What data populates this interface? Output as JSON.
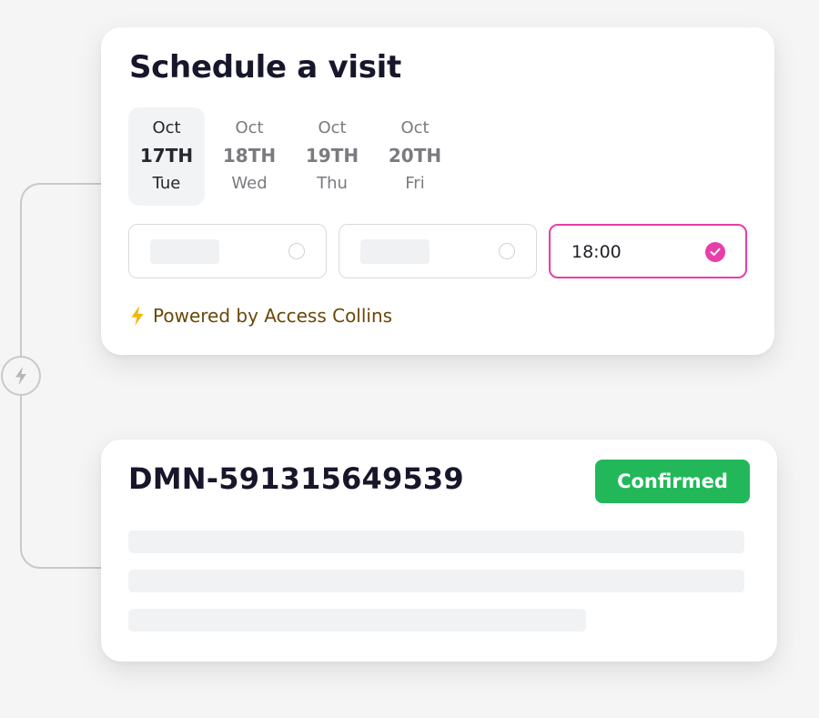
{
  "schedule": {
    "title": "Schedule a visit",
    "dates": [
      {
        "month": "Oct",
        "day": "17TH",
        "weekday": "Tue",
        "selected": true
      },
      {
        "month": "Oct",
        "day": "18TH",
        "weekday": "Wed",
        "selected": false
      },
      {
        "month": "Oct",
        "day": "19TH",
        "weekday": "Thu",
        "selected": false
      },
      {
        "month": "Oct",
        "day": "20TH",
        "weekday": "Fri",
        "selected": false
      }
    ],
    "slots": [
      {
        "time": "",
        "selected": false
      },
      {
        "time": "",
        "selected": false
      },
      {
        "time": "18:00",
        "selected": true
      }
    ],
    "powered_by": "Powered by Access Collins"
  },
  "booking": {
    "order_id": "DMN-591315649539",
    "status": "Confirmed"
  },
  "icons": {
    "connector": "lightning-bolt-icon",
    "powered": "lightning-bolt-icon",
    "selected_slot": "check-icon"
  },
  "colors": {
    "accent": "#e83ea8",
    "status_confirmed": "#22b85a",
    "powered_text": "#6a4708",
    "bolt": "#f2b705"
  }
}
